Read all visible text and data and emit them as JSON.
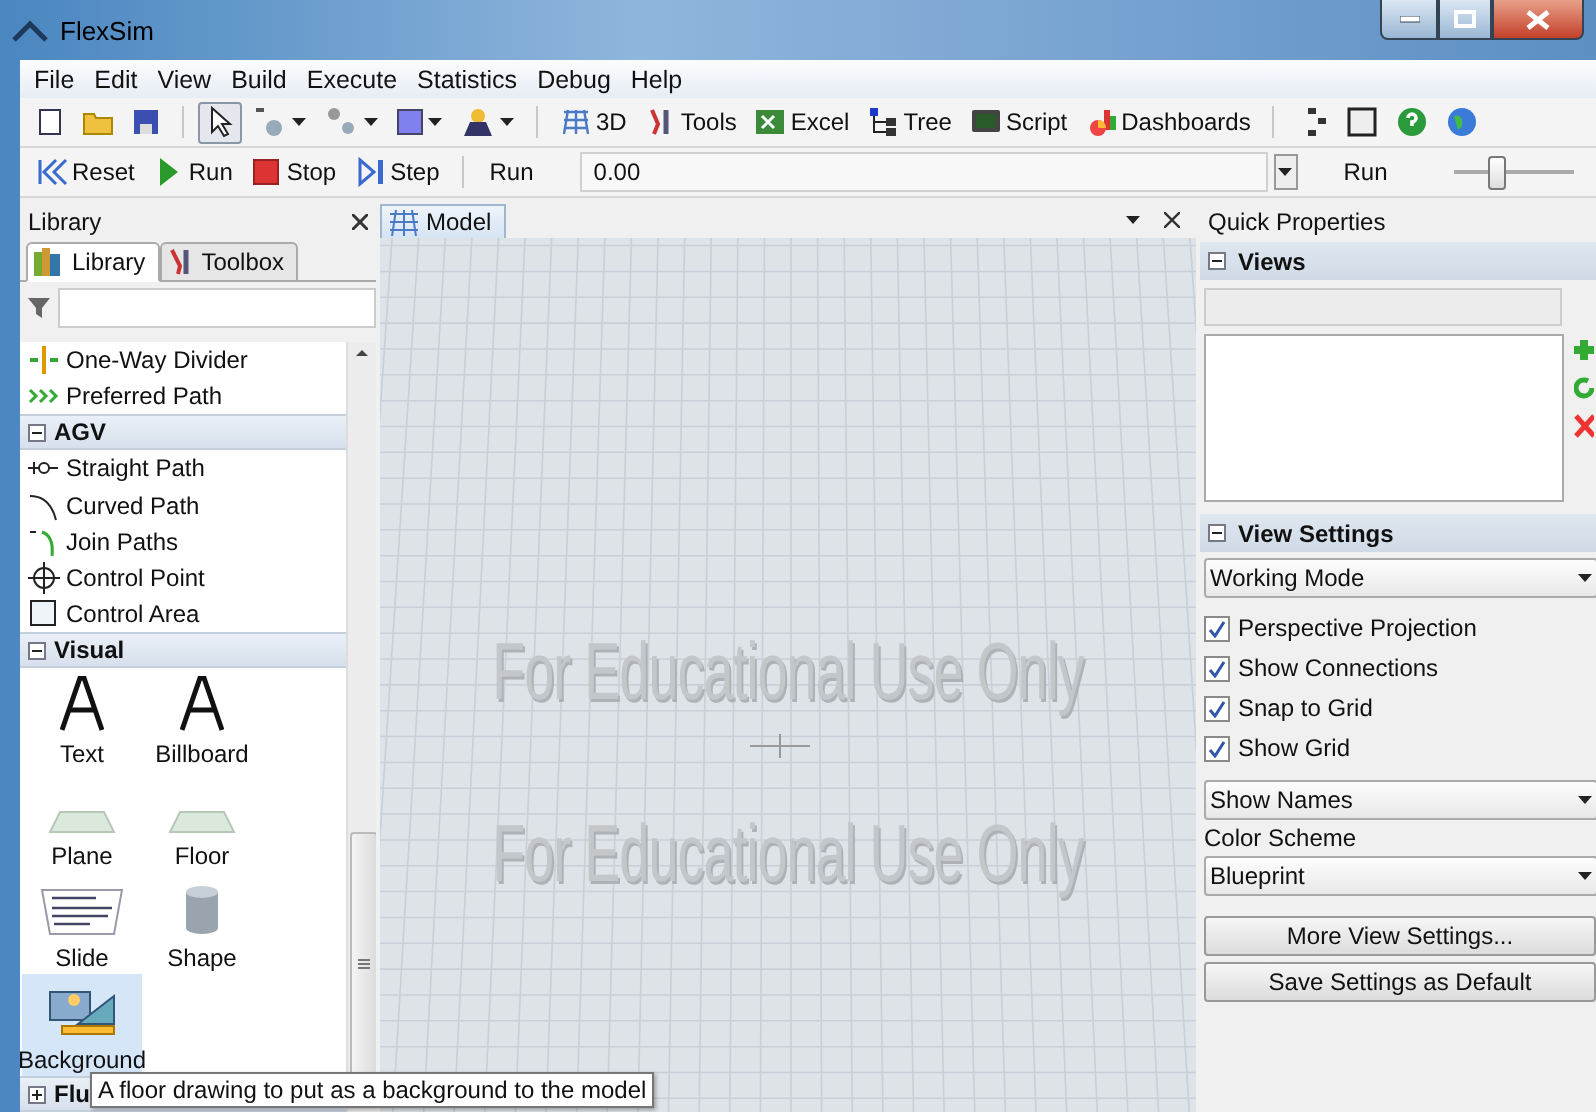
{
  "window": {
    "title": "FlexSim"
  },
  "menu": [
    "File",
    "Edit",
    "View",
    "Build",
    "Execute",
    "Statistics",
    "Debug",
    "Help"
  ],
  "main_toolbar": {
    "pointer_selected": true,
    "buttons": [
      "3D",
      "Tools",
      "Excel",
      "Tree",
      "Script",
      "Dashboards"
    ]
  },
  "run_toolbar": {
    "buttons": [
      "Reset",
      "Run",
      "Stop",
      "Step"
    ],
    "run_time_label": "Run",
    "run_time": "0.00",
    "speed_label": "Run",
    "speed": {
      "level": 0.35
    }
  },
  "library": {
    "title": "Library",
    "tabs": [
      {
        "label": "Library",
        "selected": true
      },
      {
        "label": "Toolbox",
        "selected": false
      }
    ],
    "entries": [
      {
        "kind": "item",
        "label": "One-Way Divider"
      },
      {
        "kind": "item",
        "label": "Preferred Path"
      },
      {
        "kind": "group",
        "label": "AGV",
        "expanded": true,
        "children": [
          {
            "kind": "item",
            "label": "Straight Path"
          },
          {
            "kind": "item",
            "label": "Curved Path"
          },
          {
            "kind": "item",
            "label": "Join Paths"
          },
          {
            "kind": "item",
            "label": "Control Point"
          },
          {
            "kind": "item",
            "label": "Control Area"
          }
        ]
      },
      {
        "kind": "group",
        "label": "Visual",
        "expanded": true,
        "children": [
          {
            "kind": "tile",
            "label": "Text",
            "selected": false
          },
          {
            "kind": "tile",
            "label": "Billboard",
            "selected": false
          },
          {
            "kind": "tile",
            "label": "Plane",
            "selected": false
          },
          {
            "kind": "tile",
            "label": "Floor",
            "selected": false
          },
          {
            "kind": "tile",
            "label": "Slide",
            "selected": false
          },
          {
            "kind": "tile",
            "label": "Shape",
            "selected": false
          },
          {
            "kind": "tile",
            "label": "Background",
            "selected": true
          }
        ]
      },
      {
        "kind": "group",
        "label": "Flu",
        "expanded": false
      }
    ],
    "tooltip": "A floor drawing to put as a background to the model"
  },
  "document_tabs": [
    {
      "label": "Model",
      "selected": true
    }
  ],
  "model_view": {
    "notices": [
      "For Educational Use Only",
      "For Educational Use Only"
    ]
  },
  "quick_properties": {
    "title": "Quick Properties",
    "sections": [
      {
        "kind": "views",
        "title": "Views",
        "expanded": true
      },
      {
        "kind": "settings",
        "title": "View Settings",
        "expanded": true,
        "mode": "Working Mode",
        "options": [
          {
            "label": "Perspective Projection",
            "checked": true
          },
          {
            "label": "Show Connections",
            "checked": true
          },
          {
            "label": "Snap to Grid",
            "checked": true
          },
          {
            "label": "Show Grid",
            "checked": true
          }
        ],
        "names": "Show Names",
        "color_scheme_label": "Color Scheme",
        "color_scheme": "Blueprint",
        "buttons": [
          "More View Settings...",
          "Save Settings as Default"
        ]
      }
    ]
  }
}
